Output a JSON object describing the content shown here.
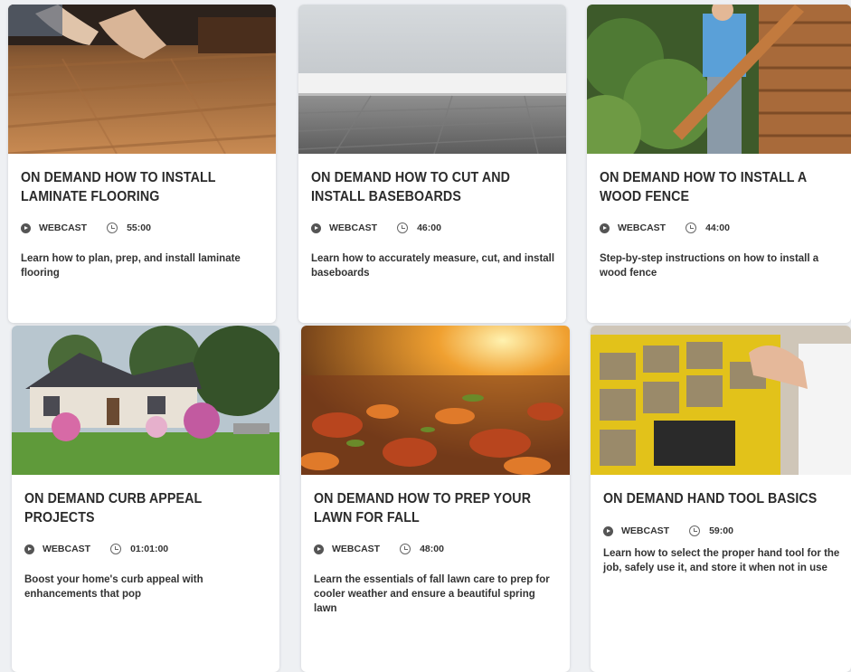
{
  "cards": [
    {
      "title": "ON DEMAND HOW TO INSTALL LAMINATE FLOORING",
      "type": "WEBCAST",
      "duration": "55:00",
      "description": "Learn how to plan, prep, and install laminate flooring",
      "image": "laminate-flooring-image"
    },
    {
      "title": "ON DEMAND HOW TO CUT AND INSTALL BASEBOARDS",
      "type": "WEBCAST",
      "duration": "46:00",
      "description": "Learn how to accurately measure, cut, and install baseboards",
      "image": "baseboards-image"
    },
    {
      "title": "ON DEMAND HOW TO INSTALL A WOOD FENCE",
      "type": "WEBCAST",
      "duration": "44:00",
      "description": "Step-by-step instructions on how to install a wood fence",
      "image": "wood-fence-image"
    },
    {
      "title": "ON DEMAND CURB APPEAL PROJECTS",
      "type": "WEBCAST",
      "duration": "01:01:00",
      "description": "Boost your home's curb appeal with enhancements that pop",
      "image": "house-curb-appeal-image"
    },
    {
      "title": "ON DEMAND HOW TO PREP YOUR LAWN FOR FALL",
      "type": "WEBCAST",
      "duration": "48:00",
      "description": "Learn the essentials of fall lawn care to prep for cooler weather and ensure a beautiful spring lawn",
      "image": "fall-leaves-lawn-image"
    },
    {
      "title": "ON DEMAND HAND TOOL BASICS",
      "type": "WEBCAST",
      "duration": "59:00",
      "description": "Learn how to select the proper hand tool for the job, safely use it, and store it when not in use",
      "image": "hardware-organizer-image"
    }
  ],
  "colors": {
    "text": "#2b2b2b",
    "card": "#ffffff",
    "background": "#eef0f3"
  }
}
